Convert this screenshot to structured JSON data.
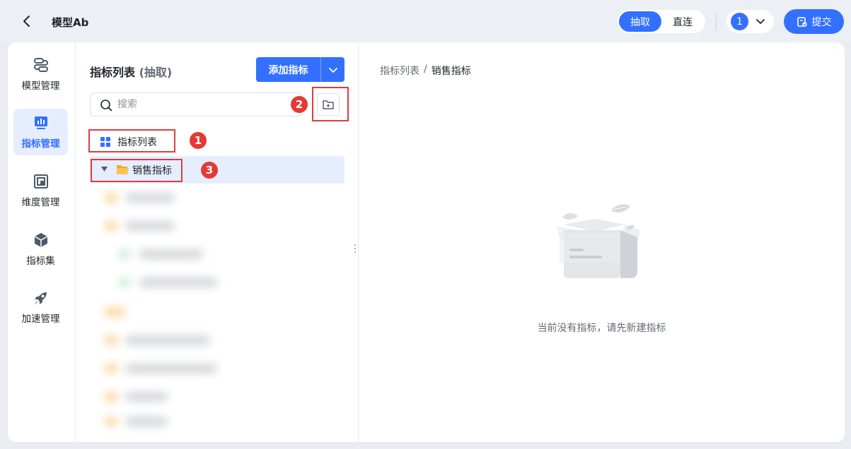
{
  "header": {
    "title": "模型Ab",
    "mode_extract": "抽取",
    "mode_direct": "直连",
    "version": "1",
    "submit_label": "提交"
  },
  "nav": {
    "items": [
      {
        "label": "模型管理",
        "icon": "model-icon"
      },
      {
        "label": "指标管理",
        "icon": "metric-icon",
        "active": true
      },
      {
        "label": "维度管理",
        "icon": "dimension-icon"
      },
      {
        "label": "指标集",
        "icon": "cube-icon"
      },
      {
        "label": "加速管理",
        "icon": "rocket-icon"
      }
    ]
  },
  "panel": {
    "title": "指标列表",
    "title_sub": "(抽取)",
    "add_label": "添加指标",
    "search_placeholder": "搜索",
    "tree_root_label": "指标列表",
    "selected_folder_label": "销售指标",
    "badges": [
      "1",
      "2",
      "3"
    ]
  },
  "content": {
    "breadcrumb_root": "指标列表",
    "breadcrumb_sep": "/",
    "breadcrumb_current": "销售指标",
    "empty_text": "当前没有指标，请先新建指标"
  },
  "colors": {
    "primary": "#3370ff",
    "annotation_red": "#e03c3c",
    "folder": "#f7a623"
  }
}
